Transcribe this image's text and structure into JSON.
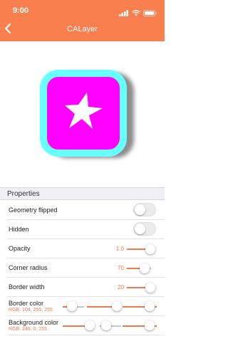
{
  "status_bar": {
    "time": "9:00"
  },
  "nav": {
    "title": "CALayer"
  },
  "section": {
    "title": "Properties"
  },
  "rows": {
    "geometry_flipped": {
      "label": "Geometry flipped",
      "on": false
    },
    "hidden": {
      "label": "Hidden",
      "on": false
    },
    "opacity": {
      "label": "Opacity",
      "value": "1.0",
      "fraction": 1.0
    },
    "corner_radius": {
      "label": "Corner radius",
      "value": "70",
      "fraction": 0.68
    },
    "border_width": {
      "label": "Border width",
      "value": "20",
      "fraction": 1.0
    },
    "border_color": {
      "label": "Border color",
      "rgb": "RGB: 104, 255, 255",
      "channels": [
        104,
        255,
        255
      ]
    },
    "background_color": {
      "label": "Background color",
      "rgb": "RGB: 248, 0, 255",
      "channels": [
        248,
        0,
        255
      ]
    }
  },
  "colors": {
    "accent": "#f07a4e",
    "header": "#fa7f4f",
    "layer_fill": "#ff00ff",
    "layer_border": "#68ffff"
  },
  "icons": [
    "back-chevron-icon",
    "signal-icon",
    "wifi-icon",
    "battery-icon",
    "star-icon"
  ]
}
